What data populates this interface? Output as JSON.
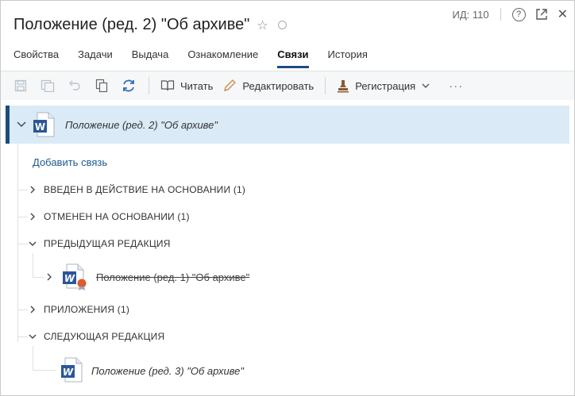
{
  "header": {
    "title": "Положение (ред. 2) \"Об архиве\"",
    "id_label": "ИД: 110",
    "help_symbol": "?",
    "close_symbol": "✕"
  },
  "tabs": [
    {
      "label": "Свойства"
    },
    {
      "label": "Задачи"
    },
    {
      "label": "Выдача"
    },
    {
      "label": "Ознакомление"
    },
    {
      "label": "Связи",
      "active": true
    },
    {
      "label": "История"
    }
  ],
  "toolbar": {
    "read_label": "Читать",
    "edit_label": "Редактировать",
    "registration_label": "Регистрация",
    "more_label": "···"
  },
  "tree": {
    "root_name": "Положение (ред. 2) \"Об архиве\"",
    "add_link": "Добавить связь",
    "groups": [
      {
        "label": "ВВЕДЕН В ДЕЙСТВИЕ НА ОСНОВАНИИ (1)",
        "expanded": false
      },
      {
        "label": "ОТМЕНЕН НА ОСНОВАНИИ (1)",
        "expanded": false
      },
      {
        "label": "ПРЕДЫДУЩАЯ РЕДАКЦИЯ",
        "expanded": true
      },
      {
        "label": "ПРИЛОЖЕНИЯ (1)",
        "expanded": false
      },
      {
        "label": "СЛЕДУЮЩАЯ РЕДАКЦИЯ",
        "expanded": true
      }
    ],
    "previous_doc": "Положение (ред. 1) \"Об архиве\"",
    "next_doc": "Положение (ред. 3) \"Об архиве\""
  },
  "colors": {
    "accent": "#1a4c80",
    "selected_row": "#dbeaf7",
    "word_blue": "#2b579a",
    "badge_orange": "#e05a2b"
  }
}
